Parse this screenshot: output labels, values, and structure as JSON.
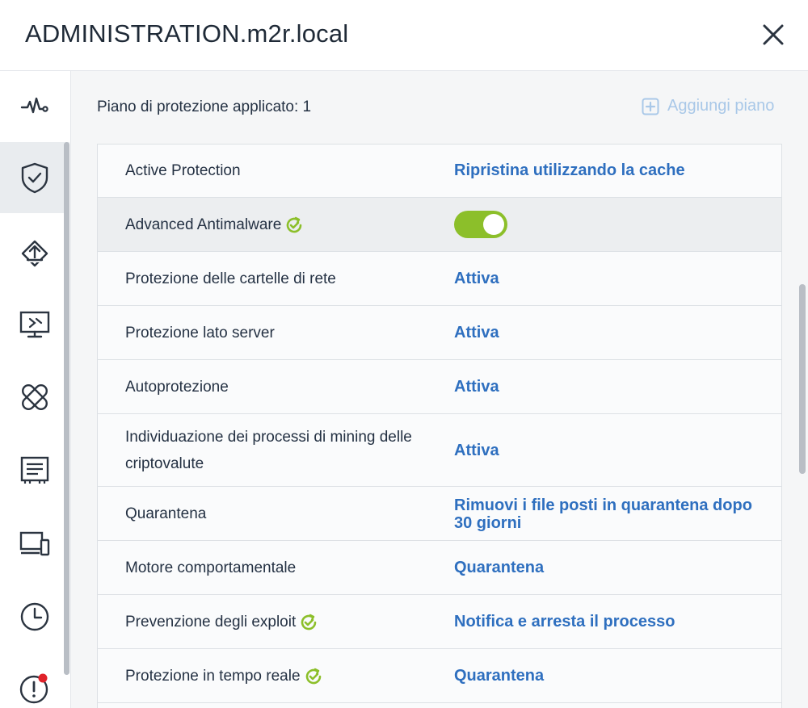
{
  "window": {
    "title": "ADMINISTRATION.m2r.local",
    "close_icon": "close-icon"
  },
  "sidebar": {
    "items": [
      {
        "icon": "activity-icon",
        "active": false
      },
      {
        "icon": "shield-check-icon",
        "active": true
      },
      {
        "icon": "backup-upload-icon",
        "active": false
      },
      {
        "icon": "remote-desktop-icon",
        "active": false
      },
      {
        "icon": "patch-bandage-icon",
        "active": false
      },
      {
        "icon": "report-icon",
        "active": false
      },
      {
        "icon": "devices-icon",
        "active": false
      },
      {
        "icon": "clock-icon",
        "active": false
      },
      {
        "icon": "alert-icon",
        "active": false,
        "badge_color": "#e0222a"
      }
    ]
  },
  "header": {
    "plan_label": "Piano di protezione applicato: 1",
    "add_plan_label": "Aggiungi piano",
    "add_plan_icon": "plus-square-icon"
  },
  "colors": {
    "accent": "#2e6fbf",
    "toggle_on": "#8cbf2a",
    "check": "#8cbf2a",
    "badge": "#e0222a"
  },
  "settings": [
    {
      "name": "Active Protection",
      "value": "Ripristina utilizzando la cache",
      "check": false
    },
    {
      "name": "Advanced Antimalware",
      "value": "",
      "toggle": true,
      "toggle_on": true,
      "check": true
    },
    {
      "name": "Protezione delle cartelle di rete",
      "value": "Attiva",
      "check": false
    },
    {
      "name": "Protezione lato server",
      "value": "Attiva",
      "check": false
    },
    {
      "name": "Autoprotezione",
      "value": "Attiva",
      "check": false
    },
    {
      "name": "Individuazione dei processi di mining delle criptovalute",
      "value": "Attiva",
      "check": false
    },
    {
      "name": "Quarantena",
      "value": "Rimuovi i file posti in quarantena dopo 30 giorni",
      "check": false
    },
    {
      "name": "Motore comportamentale",
      "value": "Quarantena",
      "check": false
    },
    {
      "name": "Prevenzione degli exploit",
      "value": "Notifica e arresta il processo",
      "check": true
    },
    {
      "name": "Protezione in tempo reale",
      "value": "Quarantena",
      "check": true
    }
  ]
}
